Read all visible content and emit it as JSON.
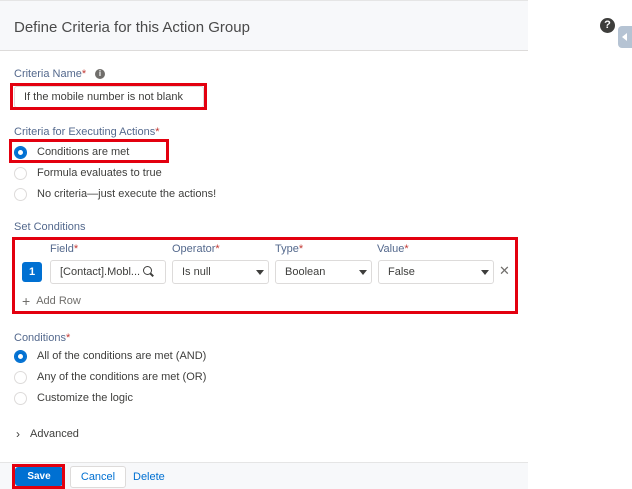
{
  "header": {
    "title": "Define Criteria for this Action Group",
    "help_glyph": "?"
  },
  "criteria_name": {
    "label": "Criteria Name",
    "required_mark": "*",
    "info_glyph": "i",
    "value": "If the mobile number is not blank"
  },
  "executing": {
    "label": "Criteria for Executing Actions",
    "required_mark": "*",
    "options": [
      {
        "label": "Conditions are met",
        "selected": true
      },
      {
        "label": "Formula evaluates to true",
        "selected": false
      },
      {
        "label": "No criteria—just execute the actions!",
        "selected": false
      }
    ]
  },
  "set_conditions": {
    "label": "Set Conditions",
    "columns": {
      "field": "Field",
      "operator": "Operator",
      "type": "Type",
      "value": "Value",
      "required_mark": "*"
    },
    "rows": [
      {
        "number": "1",
        "field": "[Contact].Mobl...",
        "operator": "Is null",
        "type": "Boolean",
        "value": "False"
      }
    ],
    "add_row": "Add Row"
  },
  "conditions": {
    "label": "Conditions",
    "required_mark": "*",
    "options": [
      {
        "label": "All of the conditions are met (AND)",
        "selected": true
      },
      {
        "label": "Any of the conditions are met (OR)",
        "selected": false
      },
      {
        "label": "Customize the logic",
        "selected": false
      }
    ]
  },
  "advanced": {
    "label": "Advanced"
  },
  "footer": {
    "save": "Save",
    "cancel": "Cancel",
    "delete": "Delete"
  },
  "colors": {
    "accent": "#0070d2",
    "highlight": "#e3000f",
    "required": "#c23934"
  },
  "icons": {
    "help": "help-icon",
    "info": "info-icon",
    "search": "search-icon",
    "caret": "chevron-down-icon",
    "remove": "close-icon",
    "add": "plus-icon",
    "expand": "chevron-right-icon"
  }
}
